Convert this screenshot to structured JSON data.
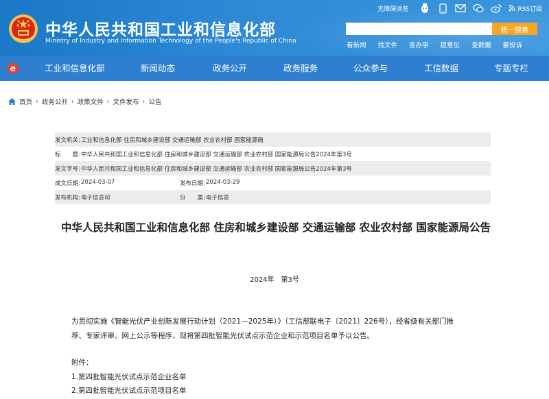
{
  "header": {
    "title": "中华人民共和国工业和信息化部",
    "subtitle": "Ministry of Industry and Information Technology of the People's Republic of China",
    "accessible_browse": "无障碍浏览",
    "rss": "RSS订阅",
    "search_placeholder": "",
    "search_button": "统一搜索",
    "quick_links": [
      "看新闻",
      "找文件",
      "查办事",
      "提意见",
      "查数据",
      "要投诉"
    ]
  },
  "nav": {
    "items": [
      "工业和信息化部",
      "新闻动态",
      "政务公开",
      "政务服务",
      "公众参与",
      "工信数据",
      "专题专栏"
    ]
  },
  "breadcrumb": [
    "首页",
    "政务公开",
    "政策文件",
    "文件发布",
    "公告"
  ],
  "info": {
    "issuer_label": "发文机关:",
    "issuer": "工业和信息化部 住房和城乡建设部 交通运输部 农业农村部 国家能源局",
    "title_label": "标　　题:",
    "title": "中华人民共和国工业和信息化部 住房和城乡建设部 交通运输部 农业农村部 国家能源局公告2024年第3号",
    "doc_no_label": "发文字号:",
    "doc_no": "中华人民共和国工业和信息化部 住房和城乡建设部 交通运输部 农业农村部 国家能源局公告2024年第3号",
    "written_label": "成文日期:",
    "written_date": "2024-03-07",
    "published_label": "发布日期:",
    "published_date": "2024-03-29",
    "org_label": "发布机构:",
    "org": "电子信息司",
    "category_label": "分　　类:",
    "category": "电子信息"
  },
  "document": {
    "title": "中华人民共和国工业和信息化部 住房和城乡建设部 交通运输部 农业农村部 国家能源局公告",
    "number": "2024年　第3号",
    "body": "为贯彻实施《智能光伏产业创新发展行动计划（2021—2025年）》（工信部联电子〔2021〕226号），经省级有关部门推荐、专家评审、网上公示等程序，现将第四批智能光伏试点示范企业和示范项目名单予以公告。",
    "attachments_label": "附件：",
    "attachments": [
      "1.第四批智能光伏试点示范企业名单",
      "2.第四批智能光伏试点示范项目名单"
    ]
  },
  "colors": {
    "header_blue": "#1a78c8",
    "nav_blue": "#2f7fd1",
    "search_orange": "#f5a623"
  }
}
